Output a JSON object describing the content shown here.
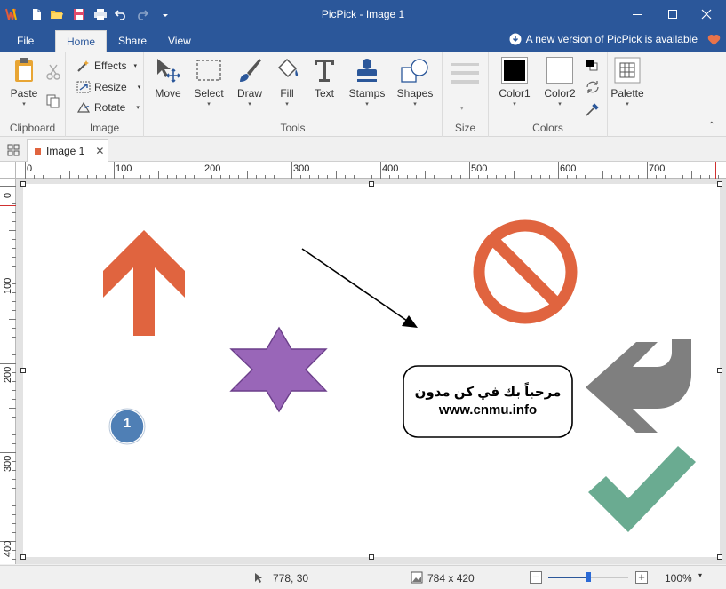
{
  "app": {
    "title": "PicPick - Image 1"
  },
  "menu_tabs": [
    {
      "label": "File"
    },
    {
      "label": "Home"
    },
    {
      "label": "Share"
    },
    {
      "label": "View"
    }
  ],
  "update_notice": "A new version of PicPick is available",
  "ribbon": {
    "clipboard": {
      "paste": "Paste",
      "group": "Clipboard"
    },
    "image": {
      "effects": "Effects",
      "resize": "Resize",
      "rotate": "Rotate",
      "group": "Image"
    },
    "tools": {
      "move": "Move",
      "select": "Select",
      "draw": "Draw",
      "fill": "Fill",
      "text": "Text",
      "stamps": "Stamps",
      "shapes": "Shapes",
      "group": "Tools"
    },
    "size": {
      "group": "Size"
    },
    "colors": {
      "color1": "Color1",
      "color2": "Color2",
      "group": "Colors",
      "color1_value": "#000000",
      "color2_value": "#ffffff"
    },
    "palette": {
      "label": "Palette"
    }
  },
  "document_tab": {
    "label": "Image 1"
  },
  "rulers": {
    "horizontal": [
      "0",
      "100",
      "200",
      "300",
      "400",
      "500",
      "600",
      "700"
    ],
    "vertical": [
      "0",
      "100",
      "200",
      "300",
      "400"
    ]
  },
  "canvas": {
    "text_line1": "مرحباً بك في كن مدون",
    "text_line2": "www.cnmu.info",
    "stamp_number": "1"
  },
  "colors": {
    "titlebar": "#2b579a",
    "orange": "#e0643f",
    "purple": "#9966b8",
    "gray": "#7f7f7f",
    "green": "#6aab91",
    "blue": "#4f7fb5"
  },
  "status": {
    "cursor": "778, 30",
    "dimensions": "784 x 420",
    "zoom": "100%",
    "zoom_fraction": 0.5
  }
}
